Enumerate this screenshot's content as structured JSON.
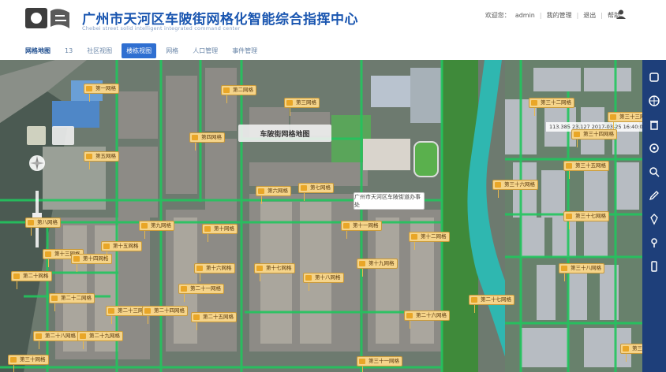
{
  "header": {
    "title": "广州市天河区车陂街网格化智能综合指挥中心",
    "subtitle": "Chebei street solid intelligent integrated command center",
    "user_label": "欢迎您：",
    "user_name": "admin",
    "links": [
      "我的管理",
      "退出",
      "帮助"
    ]
  },
  "tabs": [
    "网格地图",
    "13",
    "社区视图",
    "楼栋视图",
    "网格",
    "人口管理",
    "事件管理"
  ],
  "map": {
    "banner": "车陂街网格地图",
    "popup": "广州市天河区车陂街道办事处",
    "coords": "113.385 23.127 2017-03-25 16:40:08",
    "labels": [
      "第一网格",
      "第二网格",
      "第三网格",
      "第四网格",
      "第五网格",
      "第六网格",
      "第七网格",
      "第八网格",
      "第九网格",
      "第十网格",
      "第十一网格",
      "第十二网格",
      "第十三网格",
      "第十四网格",
      "第十五网格",
      "第十六网格",
      "第十七网格",
      "第十八网格",
      "第十九网格",
      "第二十网格",
      "第二十一网格",
      "第二十二网格",
      "第二十三网格",
      "第二十四网格",
      "第二十五网格",
      "第二十六网格",
      "第二十七网格",
      "第二十八网格",
      "第二十九网格",
      "第三十网格",
      "第三十一网格",
      "第三十二网格",
      "第三十三网格",
      "第三十四网格",
      "第三十五网格",
      "第三十六网格",
      "第三十七网格",
      "第三十八网格",
      "第三十九网格"
    ]
  },
  "sidebar": {
    "icons": [
      "layers-icon",
      "globe-icon",
      "trash-icon",
      "target-icon",
      "search-icon",
      "edit-icon",
      "pin-icon",
      "location-icon",
      "phone-icon"
    ]
  },
  "colors": {
    "title": "#1a56b0",
    "grid_line": "#22c55e",
    "label_bg": "#f5d48a",
    "sidebar": "#1e3f7a",
    "active_tab": "#2f6fd1",
    "river": "#2fb7b0"
  }
}
